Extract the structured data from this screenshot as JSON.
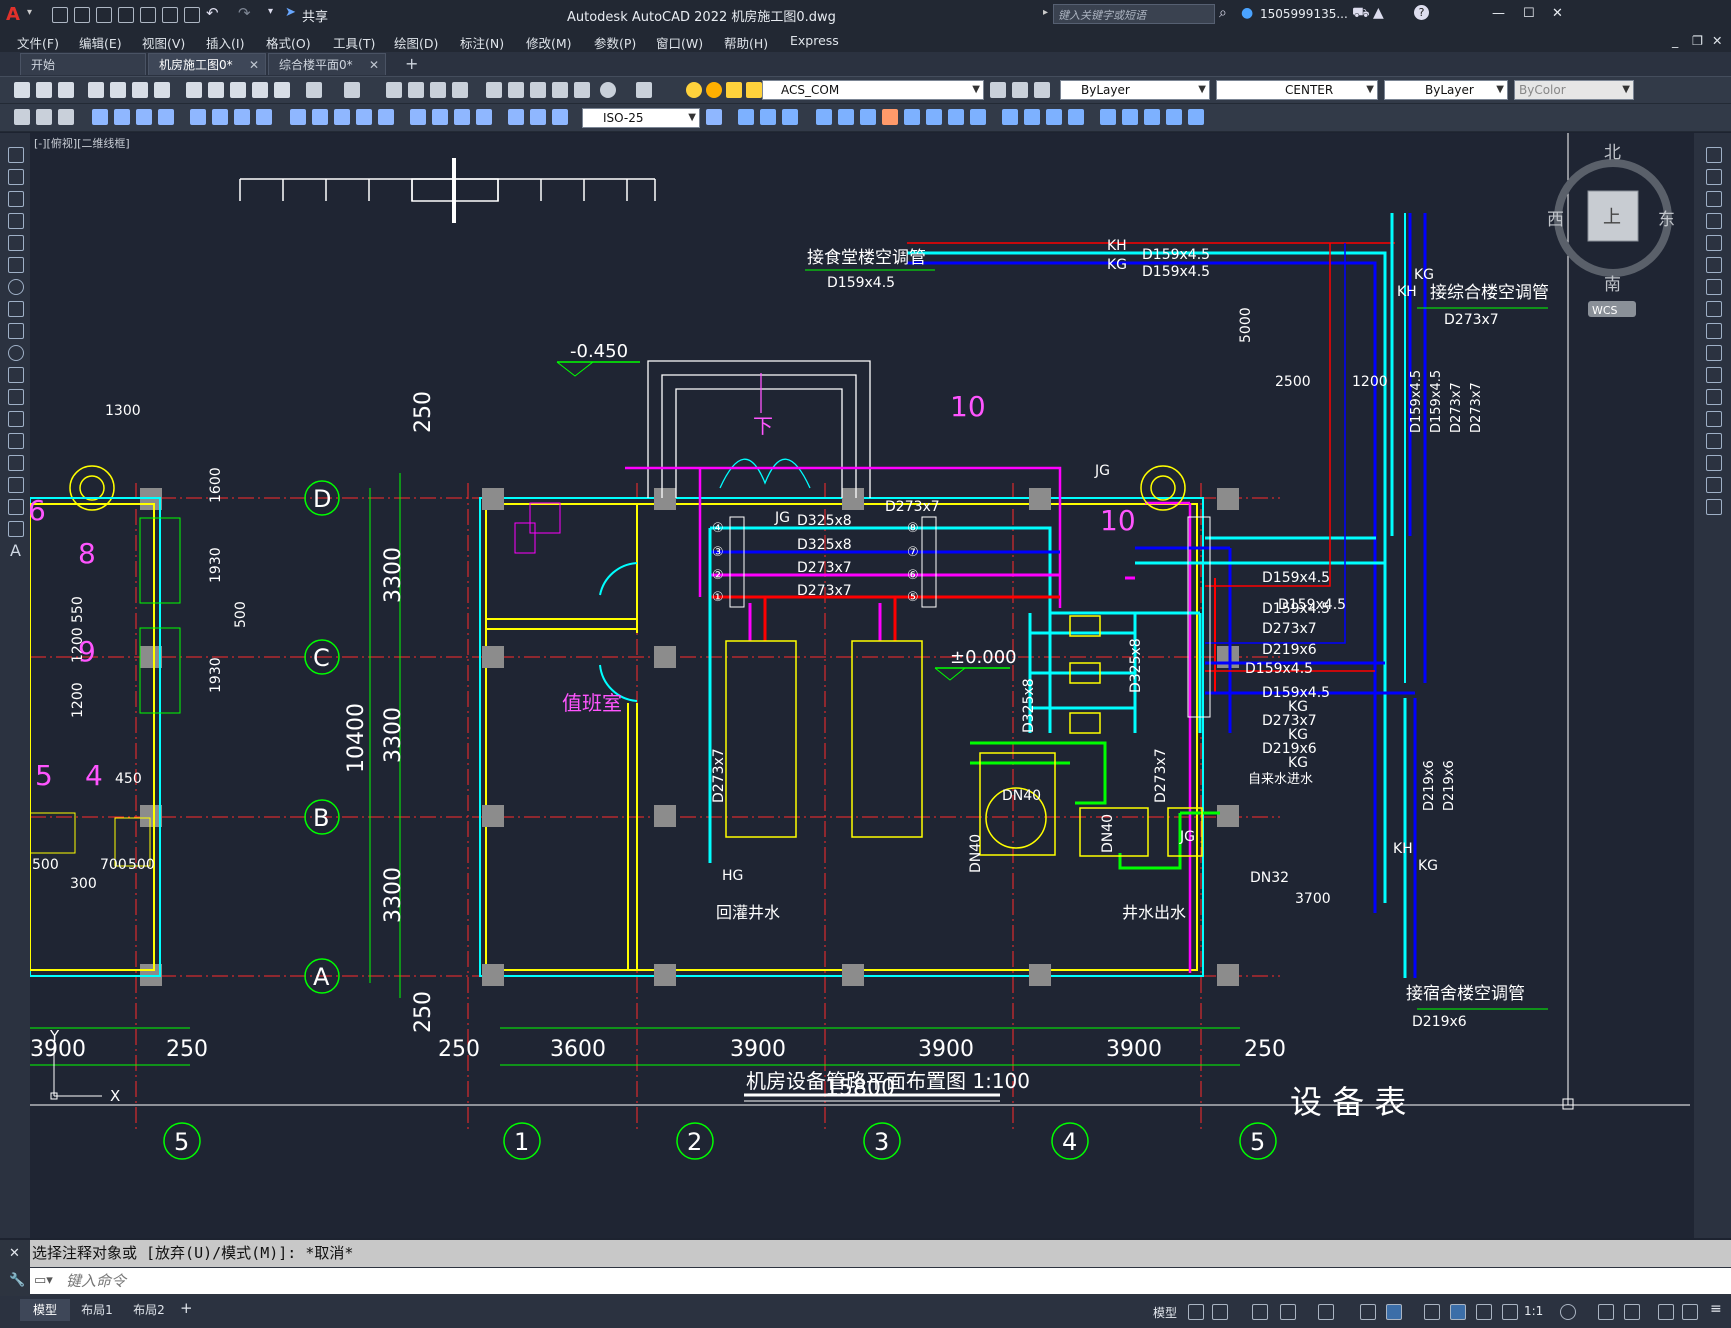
{
  "window": {
    "title": "Autodesk AutoCAD 2022    机房施工图0.dwg",
    "share_label": "共享",
    "search_placeholder": "键入关键字或短语",
    "user": "1505999135...",
    "minimize": "—",
    "maximize": "☐",
    "close": "✕"
  },
  "menu": [
    "文件(F)",
    "编辑(E)",
    "视图(V)",
    "插入(I)",
    "格式(O)",
    "工具(T)",
    "绘图(D)",
    "标注(N)",
    "修改(M)",
    "参数(P)",
    "窗口(W)",
    "帮助(H)",
    "Express"
  ],
  "tabs": [
    {
      "label": "开始",
      "active": false
    },
    {
      "label": "机房施工图0*",
      "active": true
    },
    {
      "label": "综合楼平面0*",
      "active": false
    }
  ],
  "toolbar": {
    "layer": "ACS_COM",
    "color": "ByLayer",
    "linetype": "CENTER",
    "lineweight": "ByLayer",
    "plotstyle": "ByColor",
    "dimstyle": "ISO-25"
  },
  "viewport_label": "[-][俯视][二维线框]",
  "viewcube": {
    "north": "北",
    "south": "南",
    "east": "东",
    "west": "西",
    "top": "上",
    "wcs": "WCS"
  },
  "ucs": {
    "x": "X",
    "y": "Y"
  },
  "drawing": {
    "title": "机房设备管路平面布置图  1:100",
    "table_title": "设 备 表",
    "room_label": "值班室",
    "grid_rows": [
      "D",
      "C",
      "B",
      "A"
    ],
    "grid_cols": [
      "1",
      "2",
      "3",
      "4",
      "5"
    ],
    "grid_col_left": "5",
    "row_dims": [
      "250",
      "3300",
      "3300",
      "3300",
      "250"
    ],
    "row_total": "10400",
    "col_dims": [
      "250",
      "3600",
      "3900",
      "3900",
      "3900",
      "250"
    ],
    "col_total": "15800",
    "left_dims": [
      "3900",
      "250"
    ],
    "elev_top": "-0.450",
    "elev_floor": "±0.000",
    "down": "下",
    "pipe_labels": [
      "KH",
      "KG",
      "JG",
      "HG",
      "D273x7",
      "D325x8",
      "D325x8",
      "D273x7",
      "D273x7",
      "D159x4.5",
      "D159x4.5",
      "D159x4.5",
      "D273x7",
      "D219x6",
      "D159x4.5",
      "D159x4.5",
      "KG",
      "D273x7",
      "KG",
      "D219x6",
      "KG",
      "DN40",
      "DN40",
      "DN40",
      "DN32",
      "JG",
      "D325x8",
      "D325x8",
      "D273x7",
      "D273x7"
    ],
    "notes": {
      "canteen": "接食堂楼空调管",
      "canteen_size": "D159x4.5",
      "complex": "接综合楼空调管",
      "complex_size": "D273x7",
      "dorm": "接宿舍楼空调管",
      "dorm_size": "D219x6",
      "recharge": "回灌井水",
      "well_out": "井水出水",
      "tap_water": "自来水进水",
      "d159a": "D159x4.5",
      "d159b": "D159x4.5"
    },
    "misc_dims": [
      "5000",
      "2500",
      "1200",
      "3700",
      "1300",
      "1600",
      "1930",
      "1930",
      "500",
      "550",
      "1200",
      "1200",
      "450",
      "500",
      "700",
      "500",
      "300"
    ],
    "equip_nums": [
      "10",
      "10",
      "8",
      "9",
      "6",
      "5",
      "4"
    ],
    "valve_nums": [
      "④",
      "③",
      "②",
      "①",
      "⑧",
      "⑦",
      "⑥",
      "⑤"
    ],
    "vertical_sizes": [
      "D159x4.5",
      "D159x4.5",
      "D273x7",
      "D273x7",
      "D219x6",
      "D219x6"
    ]
  },
  "command": {
    "history": "选择注释对象或 [放弃(U)/模式(M)]: *取消*",
    "placeholder": "键入命令"
  },
  "status": {
    "tabs": [
      "模型",
      "布局1",
      "布局2"
    ],
    "model_btn": "模型",
    "scale": "1:1"
  },
  "colors": {
    "bg": "#1f2533",
    "cyan": "#00ffff",
    "blue": "#0000ff",
    "magenta": "#ff00ff",
    "red": "#ff0000",
    "yellow": "#ffff00",
    "green": "#00ff00",
    "white": "#ffffff"
  }
}
